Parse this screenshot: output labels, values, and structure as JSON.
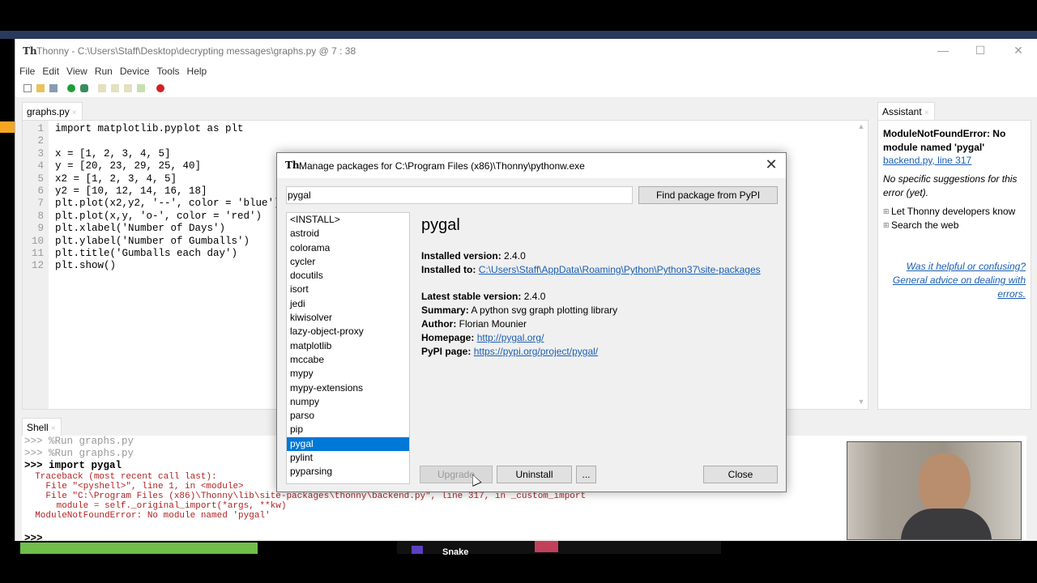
{
  "window": {
    "title": "Thonny  -  C:\\Users\\Staff\\Desktop\\decrypting messages\\graphs.py  @  7 : 38",
    "logo": "Th",
    "controls": {
      "minimize": "—",
      "maximize": "☐",
      "close": "✕"
    }
  },
  "menu": [
    "File",
    "Edit",
    "View",
    "Run",
    "Device",
    "Tools",
    "Help"
  ],
  "editor": {
    "tab_label": "graphs.py",
    "tab_close": "×",
    "lines": [
      {
        "n": "1",
        "text": "import matplotlib.pyplot as plt"
      },
      {
        "n": "2",
        "text": ""
      },
      {
        "n": "3",
        "text": "x = [1, 2, 3, 4, 5]"
      },
      {
        "n": "4",
        "text": "y = [20, 23, 29, 25, 40]"
      },
      {
        "n": "5",
        "text": "x2 = [1, 2, 3, 4, 5]"
      },
      {
        "n": "6",
        "text": "y2 = [10, 12, 14, 16, 18]"
      },
      {
        "n": "7",
        "text": "plt.plot(x2,y2, '--', color = 'blue')"
      },
      {
        "n": "8",
        "text": "plt.plot(x,y, 'o-', color = 'red')"
      },
      {
        "n": "9",
        "text": "plt.xlabel('Number of Days')"
      },
      {
        "n": "10",
        "text": "plt.ylabel('Number of Gumballs')"
      },
      {
        "n": "11",
        "text": "plt.title('Gumballs each day')"
      },
      {
        "n": "12",
        "text": "plt.show()"
      }
    ]
  },
  "shell": {
    "tab_label": "Shell",
    "tab_close": "×",
    "lines": [
      {
        "cls": "gray",
        "text": ">>> %Run graphs.py"
      },
      {
        "cls": "gray",
        "text": ">>> %Run graphs.py"
      },
      {
        "cls": "bold",
        "text": ">>> import pygal"
      },
      {
        "cls": "err",
        "text": "  Traceback (most recent call last):"
      },
      {
        "cls": "err",
        "text": "    File \"<pyshell>\", line 1, in <module>"
      },
      {
        "cls": "err",
        "text": "    File \"C:\\Program Files (x86)\\Thonny\\lib\\site-packages\\thonny\\backend.py\", line 317, in _custom_import"
      },
      {
        "cls": "err",
        "text": "      module = self._original_import(*args, **kw)"
      },
      {
        "cls": "err",
        "text": "  ModuleNotFoundError: No module named 'pygal'"
      },
      {
        "cls": "",
        "text": ""
      },
      {
        "cls": "bold",
        "text": ">>>"
      }
    ]
  },
  "assistant": {
    "tab_label": "Assistant",
    "tab_close": "×",
    "error_title": "ModuleNotFoundError: No module named 'pygal'",
    "location_link": "backend.py, line 317",
    "no_suggestions": "No specific suggestions for this error (yet).",
    "bullets": [
      "Let Thonny developers know",
      "Search the web"
    ],
    "help_link": "Was it helpful or confusing? General advice on dealing with errors."
  },
  "dialog": {
    "logo": "Th",
    "title": "Manage packages for C:\\Program Files (x86)\\Thonny\\pythonw.exe",
    "close": "✕",
    "search_value": "pygal",
    "find_button": "Find package from PyPI",
    "packages": [
      "<INSTALL>",
      "astroid",
      "colorama",
      "cycler",
      "docutils",
      "isort",
      "jedi",
      "kiwisolver",
      "lazy-object-proxy",
      "matplotlib",
      "mccabe",
      "mypy",
      "mypy-extensions",
      "numpy",
      "parso",
      "pip",
      "pygal",
      "pylint",
      "pyparsing"
    ],
    "selected_package": "pygal",
    "info": {
      "name": "pygal",
      "installed_version_label": "Installed version:",
      "installed_version": "2.4.0",
      "installed_to_label": "Installed to:",
      "installed_to": "C:\\Users\\Staff\\AppData\\Roaming\\Python\\Python37\\site-packages",
      "latest_label": "Latest stable version:",
      "latest": "2.4.0",
      "summary_label": "Summary:",
      "summary": "A python svg graph plotting library",
      "author_label": "Author:",
      "author": "Florian Mounier",
      "homepage_label": "Homepage:",
      "homepage": "http://pygal.org/",
      "pypi_label": "PyPI page:",
      "pypi": "https://pypi.org/project/pygal/"
    },
    "buttons": {
      "upgrade": "Upgrade",
      "uninstall": "Uninstall",
      "more": "...",
      "close": "Close"
    }
  },
  "taskbar": {
    "app_label": "Snake"
  },
  "colors": {
    "selection": "#0078d7",
    "link": "#1a5fb4",
    "error_text": "#b22222"
  }
}
